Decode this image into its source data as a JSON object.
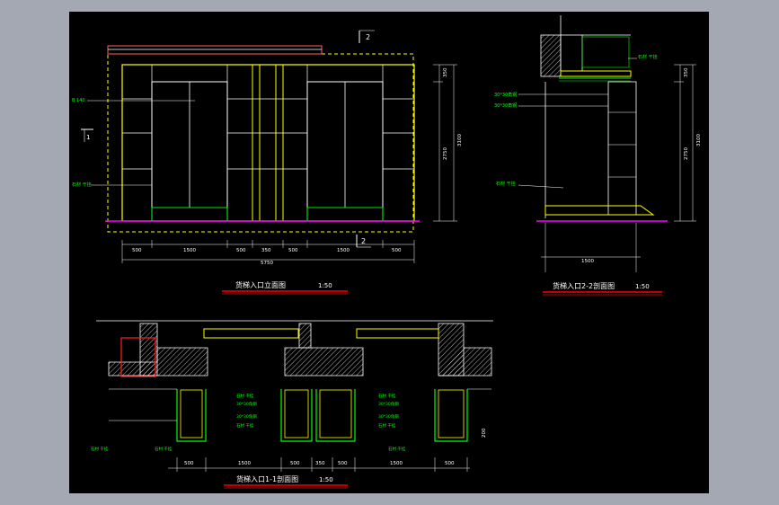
{
  "colors": {
    "background": "#000000",
    "frame": "#a3a8b2",
    "line_yellow": "#ffff00",
    "line_white": "#ffffff",
    "line_green": "#00ff00",
    "line_magenta": "#ff00ff",
    "line_red": "#ff2020",
    "line_cyan": "#00ffff"
  },
  "elevation": {
    "title": "货梯入口立面图",
    "scale": "1:50",
    "section_mark_top": "2",
    "section_mark_bottom": "2",
    "section_mark_left": "1",
    "material_label_a": "B 140",
    "material_label_b": "石材 干挂",
    "dims_bottom": [
      "500",
      "1500",
      "500",
      "350",
      "500",
      "1500",
      "500"
    ],
    "dim_total": "5750",
    "dims_right": [
      "350",
      "2750",
      "3100"
    ]
  },
  "section22": {
    "title": "货梯入口2-2剖面图",
    "scale": "1:50",
    "labels": [
      "石材 干挂",
      "30*30角钢",
      "30*30角钢",
      "石材 干挂"
    ],
    "dims_right": [
      "350",
      "2750",
      "3100"
    ],
    "dim_bottom": "1500"
  },
  "section11": {
    "title": "货梯入口1-1剖面图",
    "scale": "1:50",
    "labels_left": [
      "石材 干挂",
      "30*30角钢",
      "30*30角钢",
      "石材 干挂"
    ],
    "labels_right": [
      "石材 干挂",
      "30*30角钢",
      "30*30角钢",
      "石材 干挂"
    ],
    "label_bottom_left": "石材 干挂",
    "label_bottom_mid": "石材 干挂",
    "label_bottom_right": "石材 干挂",
    "dims_bottom": [
      "500",
      "1500",
      "500",
      "350",
      "500",
      "1500",
      "500"
    ],
    "dim_side": "200"
  }
}
